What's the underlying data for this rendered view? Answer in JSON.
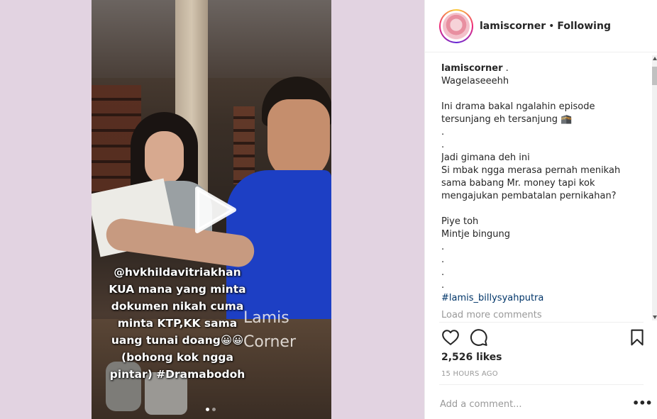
{
  "post": {
    "video": {
      "caption_overlay": [
        "@hvkhildavitriakhan",
        "KUA mana yang minta",
        "dokumen nikah cuma",
        "minta KTP,KK sama",
        "uang tunai doang😀😀",
        "(bohong kok ngga",
        "pintar) #Dramabodoh"
      ],
      "watermark": [
        "Lamis",
        "Corner"
      ],
      "carousel_count": 2,
      "carousel_active": 0
    }
  },
  "header": {
    "username": "lamiscorner",
    "separator": "•",
    "follow_status": "Following"
  },
  "caption": {
    "username": "lamiscorner",
    "lines": [
      ".",
      "Wagelaseeehh",
      "",
      "Ini drama bakal ngalahin episode",
      "tersunjang eh tersanjung 🕋",
      ".",
      ".",
      "Jadi gimana deh ini",
      "Si mbak ngga merasa pernah menikah",
      "sama babang Mr. money tapi kok",
      "mengajukan pembatalan pernikahan?",
      "",
      "Piye toh",
      "Mintje bingung",
      ".",
      ".",
      ".",
      "."
    ],
    "hashtag": "#lamis_billysyahputra"
  },
  "load_more": "Load more comments",
  "likes": "2,526 likes",
  "timestamp": "15 HOURS AGO",
  "comment_box": {
    "placeholder": "Add a comment..."
  },
  "more_label": "•••",
  "icons": {
    "like": "heart-icon",
    "comment": "comment-icon",
    "save": "bookmark-icon",
    "play": "play-icon"
  }
}
